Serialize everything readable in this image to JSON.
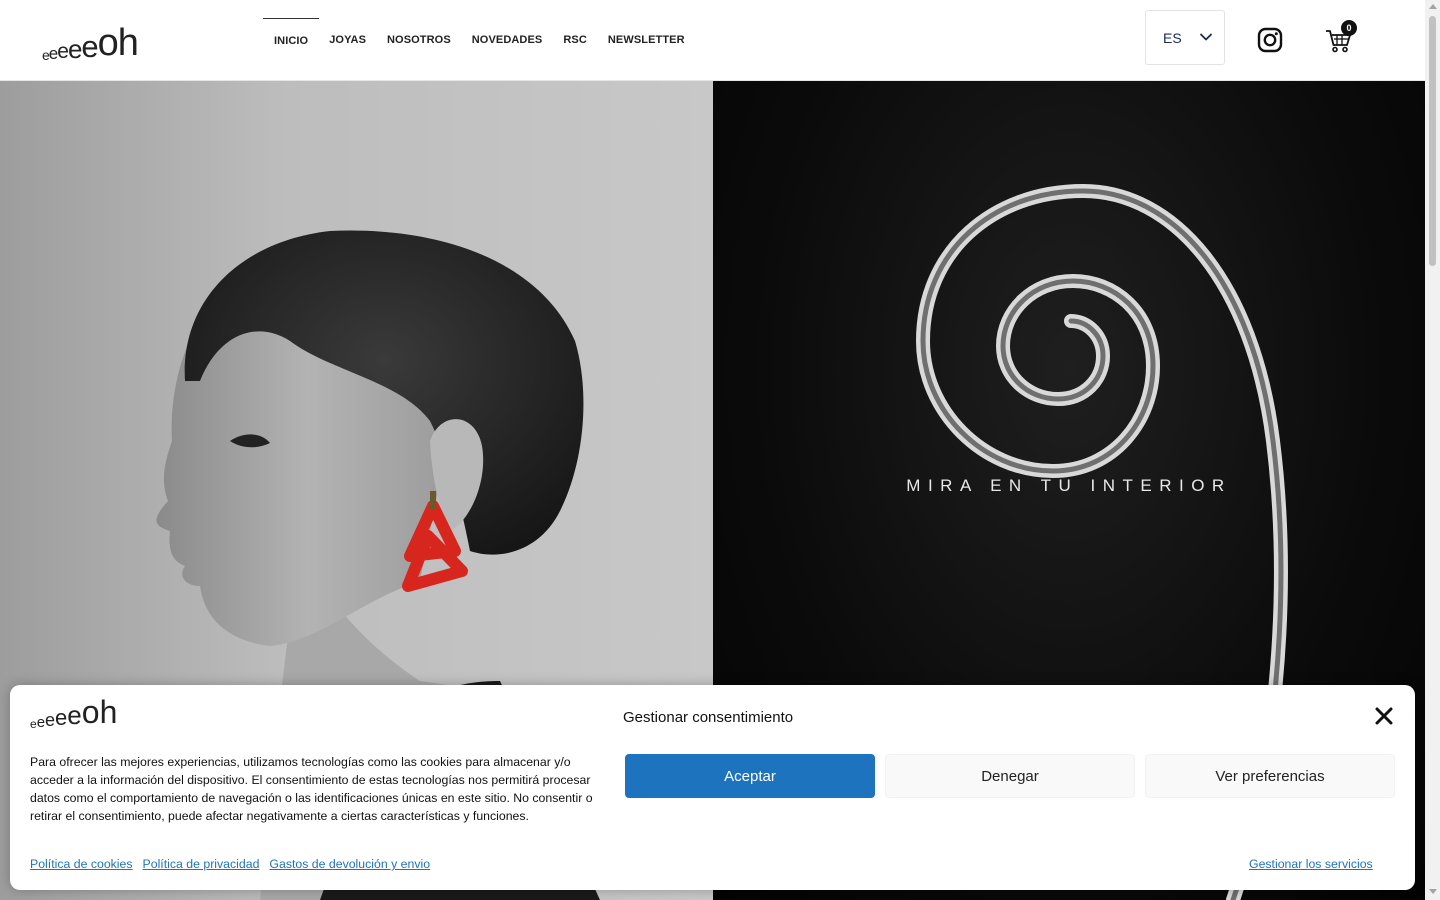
{
  "brand": {
    "logo_text": "eeeeeoh",
    "text_color": "#222222"
  },
  "nav": {
    "items": [
      {
        "label": "INICIO",
        "active": true
      },
      {
        "label": "JOYAS",
        "active": false
      },
      {
        "label": "NOSOTROS",
        "active": false
      },
      {
        "label": "NOVEDADES",
        "active": false
      },
      {
        "label": "RSC",
        "active": false
      },
      {
        "label": "NEWSLETTER",
        "active": false
      }
    ]
  },
  "header_actions": {
    "language": "ES",
    "language_icon": "chevron-down-icon",
    "social_icon": "instagram-icon",
    "cart_icon": "cart-icon",
    "cart_count": "0"
  },
  "hero": {
    "left_image": "woman-profile-red-earring",
    "right_image": "spiral-fern",
    "tagline": "MIRA EN TU INTERIOR",
    "earring_color": "#d6261d"
  },
  "consent": {
    "title": "Gestionar consentimiento",
    "text": "Para ofrecer las mejores experiencias, utilizamos tecnologías como las cookies para almacenar y/o acceder a la información del dispositivo. El consentimiento de estas tecnologías nos permitirá procesar datos como el comportamiento de navegación o las identificaciones únicas en este sitio. No consentir o retirar el consentimiento, puede afectar negativamente a ciertas características y funciones.",
    "accept_label": "Aceptar",
    "deny_label": "Denegar",
    "preferences_label": "Ver preferencias",
    "links": [
      "Política de cookies",
      "Política de privacidad",
      "Gastos de devolución y envio"
    ],
    "manage_label": "Gestionar los servicios",
    "accent_color": "#1e73be"
  }
}
